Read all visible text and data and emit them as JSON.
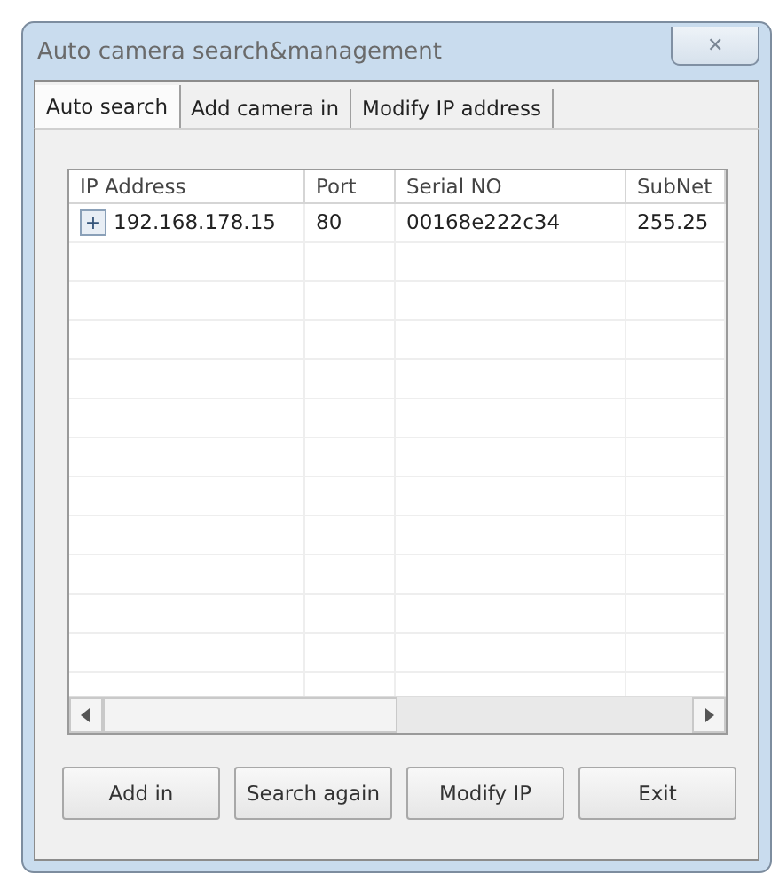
{
  "window": {
    "title": "Auto camera search&management",
    "close": "✕"
  },
  "tabs": [
    {
      "label": "Auto search",
      "selected": true
    },
    {
      "label": "Add camera in",
      "selected": false
    },
    {
      "label": "Modify IP address",
      "selected": false
    }
  ],
  "table": {
    "columns": [
      "IP Address",
      "Port",
      "Serial NO",
      "SubNet"
    ],
    "rows": [
      {
        "expander": "+",
        "cells": [
          "192.168.178.15",
          "80",
          "00168e222c34",
          "255.25"
        ]
      }
    ]
  },
  "buttons": [
    "Add in",
    "Search again",
    "Modify IP",
    "Exit"
  ]
}
